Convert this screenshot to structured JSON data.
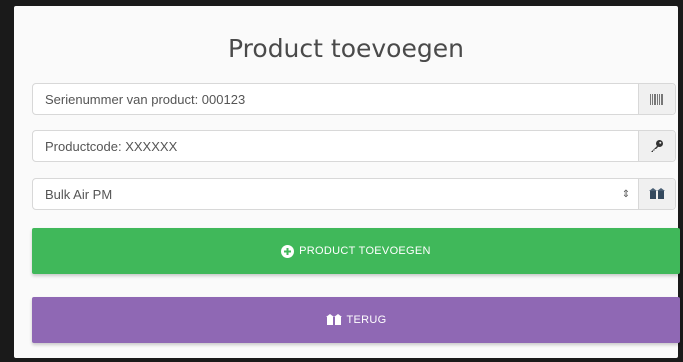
{
  "title": "Product toevoegen",
  "fields": {
    "serial": {
      "value": "Serienummer van product: 000123",
      "addon_icon": "barcode-icon"
    },
    "code": {
      "value": "Productcode: XXXXXX",
      "addon_icon": "key-icon"
    },
    "product_select": {
      "selected": "Bulk Air PM",
      "addon_icon": "boxes-icon"
    }
  },
  "buttons": {
    "add": {
      "label": "PRODUCT TOEVOEGEN",
      "icon": "plus-circle-icon",
      "color": "#40b85a"
    },
    "back": {
      "label": "TERUG",
      "icon": "boxes-icon",
      "color": "#8f68b4"
    }
  }
}
